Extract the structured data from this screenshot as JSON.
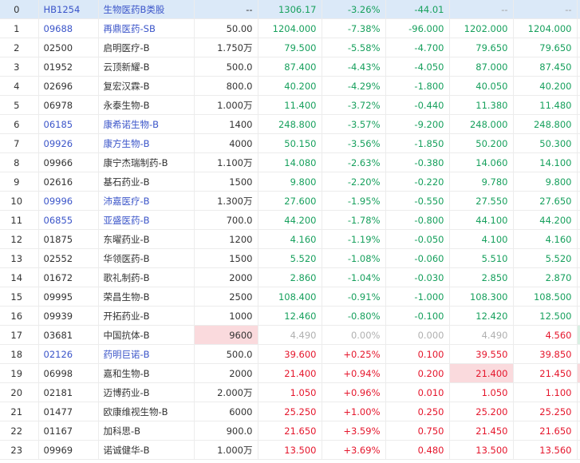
{
  "colors": {
    "up": "#e5162c",
    "down": "#17a05d",
    "flat": "#b0b0b0",
    "link": "#3b55c9",
    "header_bg": "#dbe9f8"
  },
  "rows": [
    {
      "i": "0",
      "code": "HB1254",
      "name": "生物医药B类股",
      "vol": "--",
      "price": "1306.17",
      "pct": "-3.26%",
      "chg": "-44.01",
      "bid": "--",
      "ask": "--",
      "t": "g",
      "link": true,
      "head": true
    },
    {
      "i": "1",
      "code": "09688",
      "name": "再鼎医药-SB",
      "vol": "50.00",
      "price": "1204.000",
      "pct": "-7.38%",
      "chg": "-96.000",
      "bid": "1202.000",
      "ask": "1204.000",
      "t": "g",
      "link": true
    },
    {
      "i": "2",
      "code": "02500",
      "name": "启明医疗-B",
      "vol": "1.750万",
      "price": "79.500",
      "pct": "-5.58%",
      "chg": "-4.700",
      "bid": "79.650",
      "ask": "79.650",
      "t": "g"
    },
    {
      "i": "3",
      "code": "01952",
      "name": "云顶新耀-B",
      "vol": "500.0",
      "price": "87.400",
      "pct": "-4.43%",
      "chg": "-4.050",
      "bid": "87.000",
      "ask": "87.450",
      "t": "g"
    },
    {
      "i": "4",
      "code": "02696",
      "name": "复宏汉霖-B",
      "vol": "800.0",
      "price": "40.200",
      "pct": "-4.29%",
      "chg": "-1.800",
      "bid": "40.050",
      "ask": "40.200",
      "t": "g"
    },
    {
      "i": "5",
      "code": "06978",
      "name": "永泰生物-B",
      "vol": "1.000万",
      "price": "11.400",
      "pct": "-3.72%",
      "chg": "-0.440",
      "bid": "11.380",
      "ask": "11.480",
      "t": "g"
    },
    {
      "i": "6",
      "code": "06185",
      "name": "康希诺生物-B",
      "vol": "1400",
      "price": "248.800",
      "pct": "-3.57%",
      "chg": "-9.200",
      "bid": "248.000",
      "ask": "248.800",
      "t": "g",
      "link": true
    },
    {
      "i": "7",
      "code": "09926",
      "name": "康方生物-B",
      "vol": "4000",
      "price": "50.150",
      "pct": "-3.56%",
      "chg": "-1.850",
      "bid": "50.200",
      "ask": "50.300",
      "t": "g",
      "link": true
    },
    {
      "i": "8",
      "code": "09966",
      "name": "康宁杰瑞制药-B",
      "vol": "1.100万",
      "price": "14.080",
      "pct": "-2.63%",
      "chg": "-0.380",
      "bid": "14.060",
      "ask": "14.100",
      "t": "g"
    },
    {
      "i": "9",
      "code": "02616",
      "name": "基石药业-B",
      "vol": "1500",
      "price": "9.800",
      "pct": "-2.20%",
      "chg": "-0.220",
      "bid": "9.780",
      "ask": "9.800",
      "t": "g"
    },
    {
      "i": "10",
      "code": "09996",
      "name": "沛嘉医疗-B",
      "vol": "1.300万",
      "price": "27.600",
      "pct": "-1.95%",
      "chg": "-0.550",
      "bid": "27.550",
      "ask": "27.650",
      "t": "g",
      "link": true
    },
    {
      "i": "11",
      "code": "06855",
      "name": "亚盛医药-B",
      "vol": "700.0",
      "price": "44.200",
      "pct": "-1.78%",
      "chg": "-0.800",
      "bid": "44.100",
      "ask": "44.200",
      "t": "g",
      "link": true
    },
    {
      "i": "12",
      "code": "01875",
      "name": "东曜药业-B",
      "vol": "1200",
      "price": "4.160",
      "pct": "-1.19%",
      "chg": "-0.050",
      "bid": "4.100",
      "ask": "4.160",
      "t": "g"
    },
    {
      "i": "13",
      "code": "02552",
      "name": "华领医药-B",
      "vol": "1500",
      "price": "5.520",
      "pct": "-1.08%",
      "chg": "-0.060",
      "bid": "5.510",
      "ask": "5.520",
      "t": "g"
    },
    {
      "i": "14",
      "code": "01672",
      "name": "歌礼制药-B",
      "vol": "2000",
      "price": "2.860",
      "pct": "-1.04%",
      "chg": "-0.030",
      "bid": "2.850",
      "ask": "2.870",
      "t": "g"
    },
    {
      "i": "15",
      "code": "09995",
      "name": "荣昌生物-B",
      "vol": "2500",
      "price": "108.400",
      "pct": "-0.91%",
      "chg": "-1.000",
      "bid": "108.300",
      "ask": "108.500",
      "t": "g"
    },
    {
      "i": "16",
      "code": "09939",
      "name": "开拓药业-B",
      "vol": "1000",
      "price": "12.460",
      "pct": "-0.80%",
      "chg": "-0.100",
      "bid": "12.420",
      "ask": "12.500",
      "t": "g"
    },
    {
      "i": "17",
      "code": "03681",
      "name": "中国抗体-B",
      "vol": "9600",
      "price": "4.490",
      "pct": "0.00%",
      "chg": "0.000",
      "bid": "4.490",
      "ask": "4.560",
      "t": "z",
      "volPink": true,
      "askRed": true,
      "edge": "greenedge"
    },
    {
      "i": "18",
      "code": "02126",
      "name": "药明巨诺-B",
      "vol": "500.0",
      "price": "39.600",
      "pct": "+0.25%",
      "chg": "0.100",
      "bid": "39.550",
      "ask": "39.850",
      "t": "r",
      "link": true
    },
    {
      "i": "19",
      "code": "06998",
      "name": "嘉和生物-B",
      "vol": "2000",
      "price": "21.400",
      "pct": "+0.94%",
      "chg": "0.200",
      "bid": "21.400",
      "ask": "21.450",
      "t": "r",
      "bidPink": true,
      "edge": "pinkedge"
    },
    {
      "i": "20",
      "code": "02181",
      "name": "迈博药业-B",
      "vol": "2.000万",
      "price": "1.050",
      "pct": "+0.96%",
      "chg": "0.010",
      "bid": "1.050",
      "ask": "1.100",
      "t": "r"
    },
    {
      "i": "21",
      "code": "01477",
      "name": "欧康维视生物-B",
      "vol": "6000",
      "price": "25.250",
      "pct": "+1.00%",
      "chg": "0.250",
      "bid": "25.200",
      "ask": "25.250",
      "t": "r"
    },
    {
      "i": "22",
      "code": "01167",
      "name": "加科思-B",
      "vol": "900.0",
      "price": "21.650",
      "pct": "+3.59%",
      "chg": "0.750",
      "bid": "21.450",
      "ask": "21.650",
      "t": "r"
    },
    {
      "i": "23",
      "code": "09969",
      "name": "诺诚健华-B",
      "vol": "1.000万",
      "price": "13.500",
      "pct": "+3.69%",
      "chg": "0.480",
      "bid": "13.500",
      "ask": "13.560",
      "t": "r"
    }
  ]
}
